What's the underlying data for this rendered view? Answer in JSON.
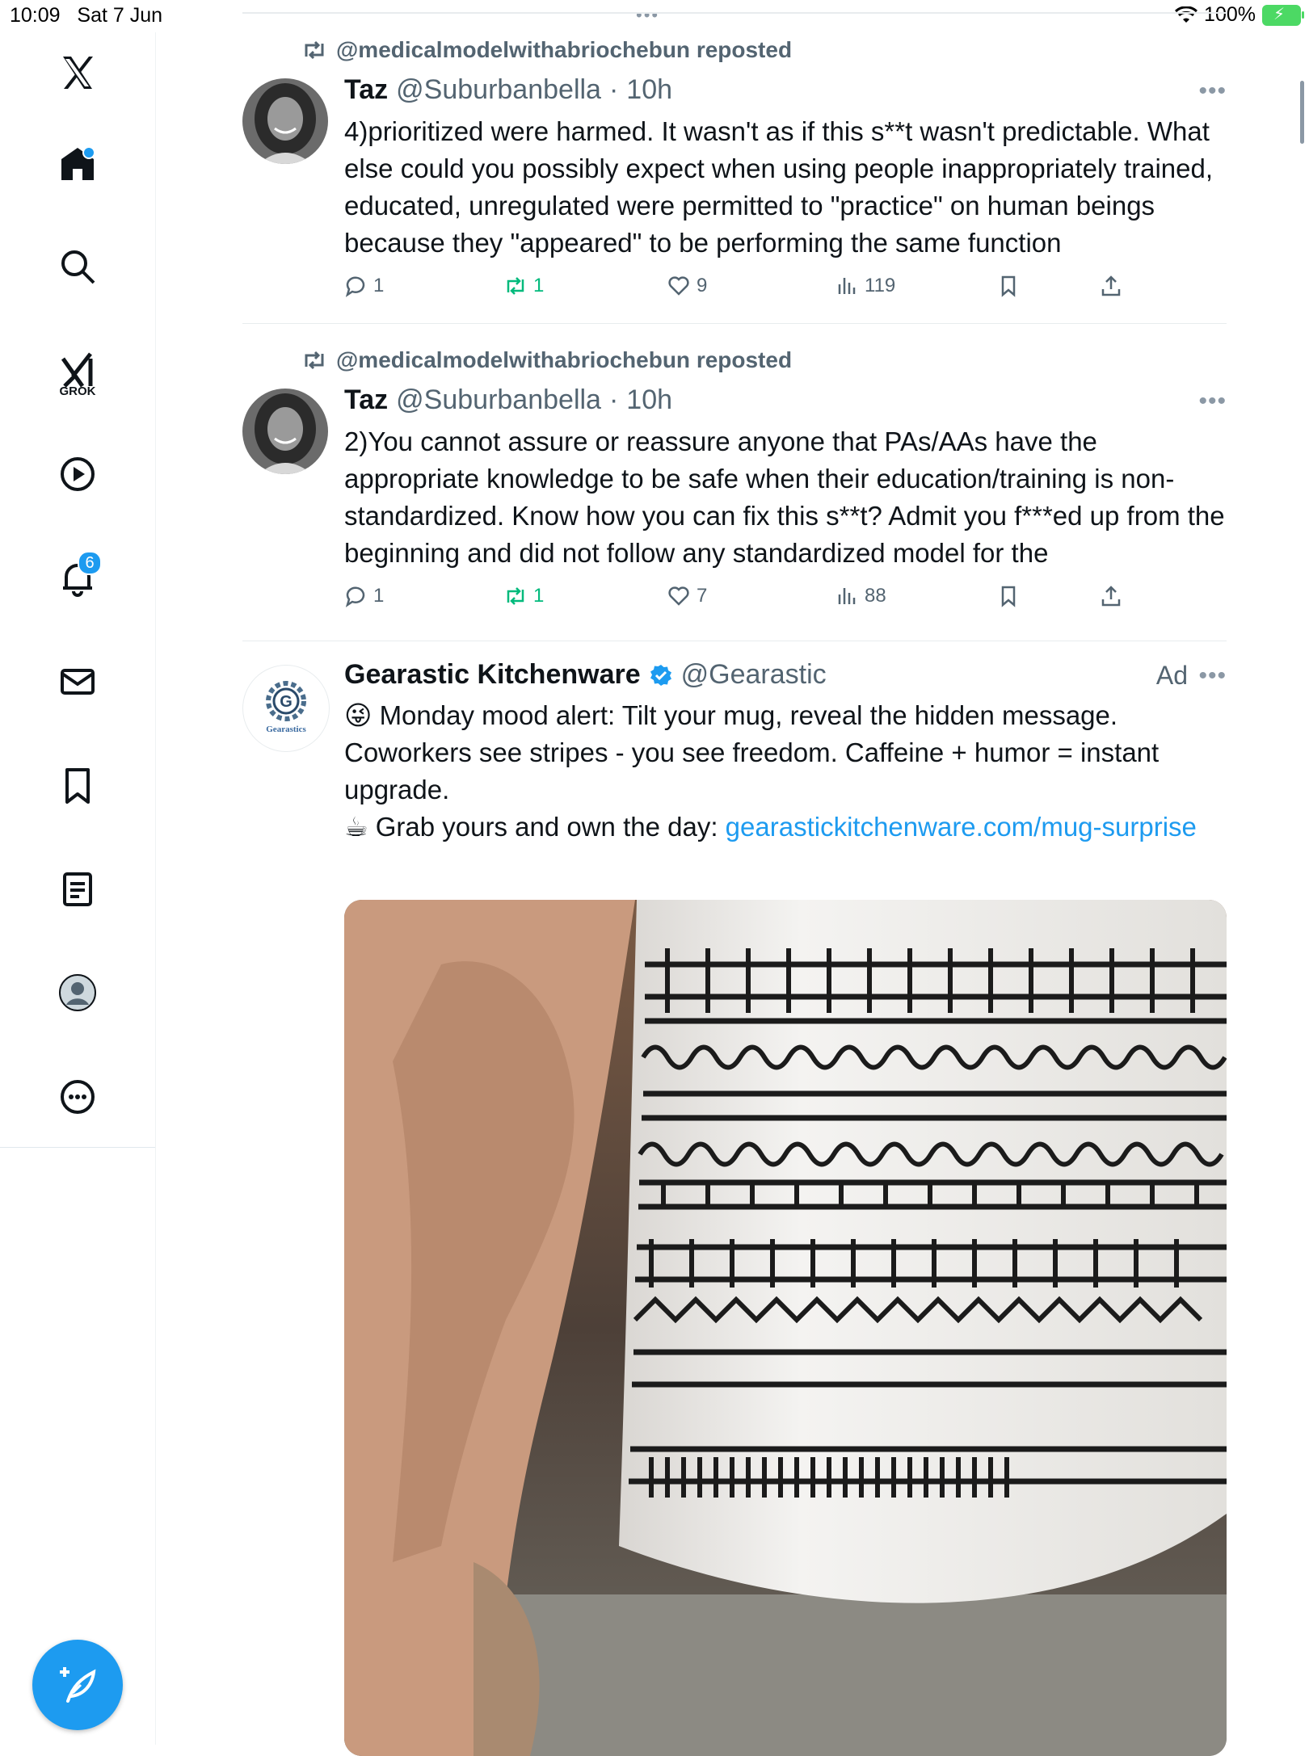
{
  "status": {
    "time": "10:09",
    "date": "Sat 7 Jun",
    "battery": "100%"
  },
  "sidebar": {
    "grok_label": "GROK",
    "notifications_count": "6"
  },
  "tweets": [
    {
      "repost_label": "@medicalmodelwithabriochebun reposted",
      "name": "Taz",
      "handle": "@Suburbanbella",
      "sep": "·",
      "time": "10h",
      "text": "4)prioritized were harmed. It wasn't as if this s**t wasn't predictable. What else could you possibly expect when using people inappropriately trained, educated, unregulated were permitted to \"practice\" on human beings because they \"appeared\" to be performing the same function",
      "replies": "1",
      "reposts": "1",
      "likes": "9",
      "views": "119"
    },
    {
      "repost_label": "@medicalmodelwithabriochebun reposted",
      "name": "Taz",
      "handle": "@Suburbanbella",
      "sep": "·",
      "time": "10h",
      "text": "2)You cannot assure or reassure anyone that PAs/AAs have the appropriate knowledge to be safe when their education/training is non-standardized. Know how you can fix this s**t? Admit you f***ed up from the beginning and did not follow any standardized model for the",
      "replies": "1",
      "reposts": "1",
      "likes": "7",
      "views": "88"
    }
  ],
  "ad": {
    "name": "Gearastic Kitchenware",
    "handle": "@Gearastic",
    "ad_label": "Ad",
    "logo_text": "Gearastics",
    "line1": "😜 Monday mood alert: Tilt your mug, reveal the hidden message. Coworkers see stripes - you see freedom. Caffeine + humor = instant upgrade.",
    "line2_prefix": "☕ Grab yours and own the day: ",
    "link": "gearastickitchenware.com/mug-surprise"
  },
  "colors": {
    "accent": "#1d9bf0",
    "repost_green": "#00ba7c",
    "muted": "#536471"
  }
}
